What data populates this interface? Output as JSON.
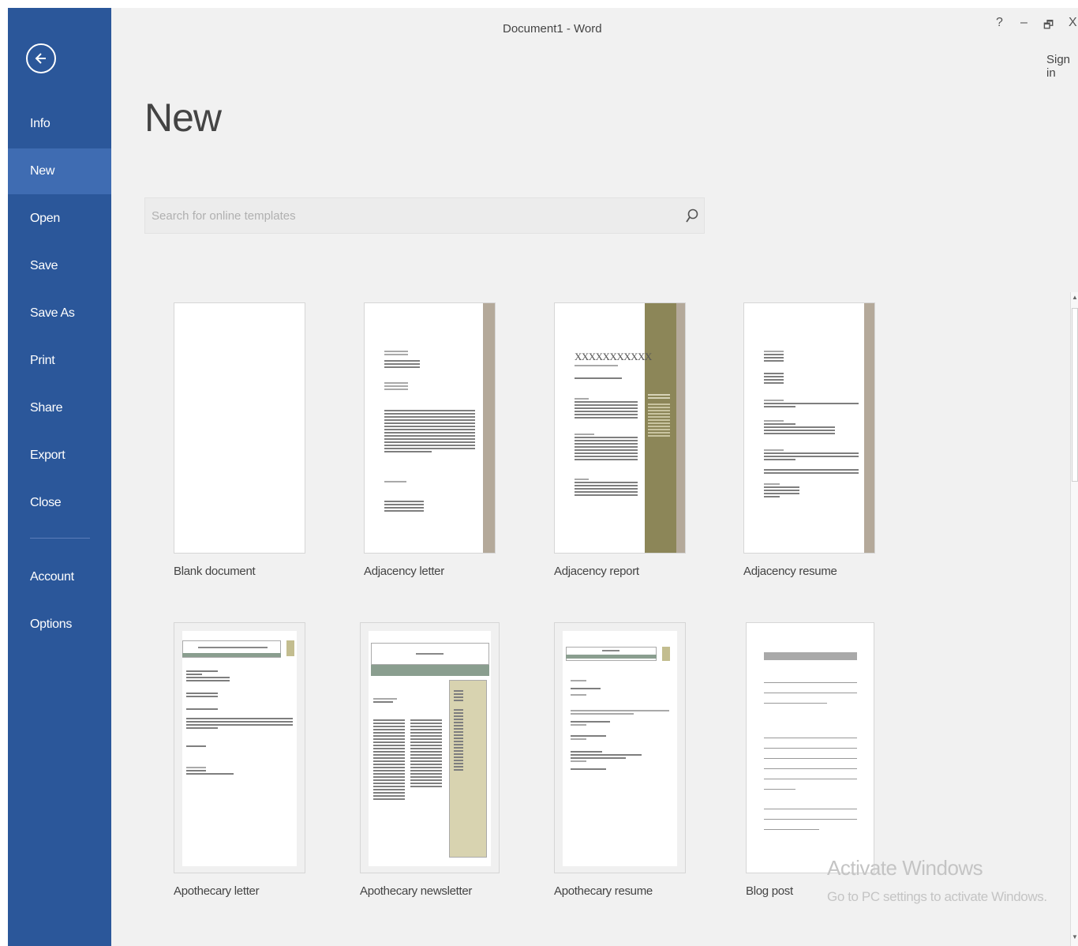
{
  "window": {
    "title": "Document1 - Word",
    "help_label": "?",
    "minimize_label": "–",
    "restore_label": "🗗",
    "close_label": "X",
    "sign_in": "Sign in"
  },
  "sidebar": {
    "items": [
      {
        "label": "Info",
        "active": false
      },
      {
        "label": "New",
        "active": true
      },
      {
        "label": "Open",
        "active": false
      },
      {
        "label": "Save",
        "active": false
      },
      {
        "label": "Save As",
        "active": false
      },
      {
        "label": "Print",
        "active": false
      },
      {
        "label": "Share",
        "active": false
      },
      {
        "label": "Export",
        "active": false
      },
      {
        "label": "Close",
        "active": false
      },
      {
        "label": "Account",
        "active": false
      },
      {
        "label": "Options",
        "active": false
      }
    ]
  },
  "main": {
    "title": "New",
    "search": {
      "placeholder": "Search for online templates",
      "value": ""
    },
    "templates": [
      {
        "label": "Blank document"
      },
      {
        "label": "Adjacency letter"
      },
      {
        "label": "Adjacency report",
        "thumb_heading": "XXXXXXXXXXX"
      },
      {
        "label": "Adjacency resume"
      },
      {
        "label": "Apothecary letter"
      },
      {
        "label": "Apothecary newsletter"
      },
      {
        "label": "Apothecary resume"
      },
      {
        "label": "Blog post"
      }
    ]
  },
  "watermark": {
    "title": "Activate Windows",
    "subtitle": "Go to PC settings to activate Windows."
  },
  "colors": {
    "sidebar": "#2b579a",
    "sidebar_active": "#3f6cb2",
    "background": "#f1f1f1",
    "accent_tan": "#b4a99a",
    "accent_olive": "#8c8658"
  }
}
